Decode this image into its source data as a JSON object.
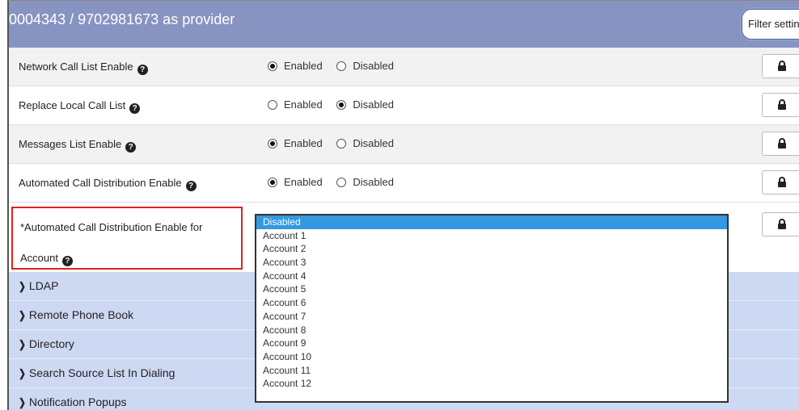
{
  "header": {
    "title": "0004343 / 9702981673 as provider",
    "filter_label": "Filter settin"
  },
  "settings": [
    {
      "label": "Network Call List Enable",
      "selected": "Enabled"
    },
    {
      "label": "Replace Local Call List",
      "selected": "Disabled"
    },
    {
      "label": "Messages List Enable",
      "selected": "Enabled"
    },
    {
      "label": "Automated Call Distribution Enable",
      "selected": "Enabled"
    }
  ],
  "radio_labels": {
    "enabled": "Enabled",
    "disabled": "Disabled"
  },
  "help_glyph": "?",
  "acd_account": {
    "label_line1": "*Automated Call Distribution Enable for",
    "label_line2": "Account",
    "selected": "Disabled",
    "options": [
      "Disabled",
      "Account 1",
      "Account 2",
      "Account 3",
      "Account 4",
      "Account 5",
      "Account 6",
      "Account 7",
      "Account 8",
      "Account 9",
      "Account 10",
      "Account 11",
      "Account 12"
    ]
  },
  "sections": [
    "LDAP",
    "Remote Phone Book",
    "Directory",
    "Search Source List In Dialing",
    "Notification Popups"
  ],
  "icons": {
    "lock": "lock-icon",
    "chevron": "chevron-right-icon",
    "help": "question-circle-icon"
  },
  "colors": {
    "header_bg": "#8794c2",
    "section_bg": "#cdd8f2",
    "highlight_border": "#e0221e",
    "selected_option": "#3399e0"
  }
}
